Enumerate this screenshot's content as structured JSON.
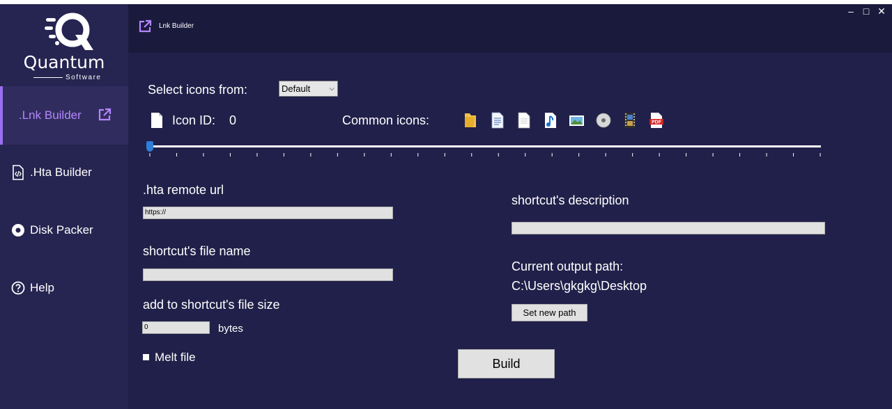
{
  "sidebar": {
    "logo": {
      "brand": "Quantum",
      "sub": "Software"
    },
    "items": [
      {
        "label": ".Lnk Builder",
        "icon": "external-link-icon",
        "active": true
      },
      {
        "label": ".Hta Builder",
        "icon": "code-file-icon",
        "active": false
      },
      {
        "label": "Disk Packer",
        "icon": "disc-icon",
        "active": false
      },
      {
        "label": "Help",
        "icon": "help-circle-icon",
        "active": false
      }
    ]
  },
  "topbar": {
    "title": "Lnk Builder",
    "icon": "external-link-icon"
  },
  "window_controls": {
    "minimize": "–",
    "maximize": "□",
    "close": "✕"
  },
  "icons_section": {
    "select_label": "Select icons from:",
    "select_value": "Default",
    "icon_id_label": "Icon ID:",
    "icon_id_value": "0",
    "common_label": "Common icons:",
    "common_icons": [
      "folder-icon",
      "text-document-icon",
      "blank-document-icon",
      "music-file-icon",
      "image-file-icon",
      "disc-icon",
      "video-file-icon",
      "pdf-file-icon"
    ],
    "slider_value": 0
  },
  "form": {
    "hta_url_label": ".hta remote url",
    "hta_url_value": "https://",
    "file_name_label": "shortcut's file name",
    "file_name_value": "",
    "file_size_label": "add to shortcut's file size",
    "file_size_value": "0",
    "file_size_unit": "bytes",
    "melt_label": "Melt file",
    "melt_checked": false,
    "description_label": "shortcut's description",
    "description_value": "",
    "output_path_label": "Current output path:",
    "output_path_value": "C:\\Users\\gkgkg\\Desktop",
    "set_path_button": "Set new path",
    "build_button": "Build"
  },
  "colors": {
    "background": "#21204a",
    "sidebar": "#262450",
    "accent": "#9b6ff0",
    "topbar": "#1a1a3d"
  }
}
